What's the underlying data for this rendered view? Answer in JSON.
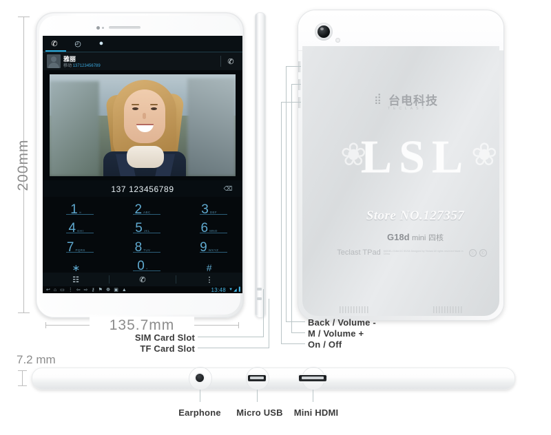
{
  "dimensions": {
    "height_label": "200mm",
    "width_label": "135.7mm",
    "thickness_label": "7.2 mm"
  },
  "callouts": {
    "left": [
      {
        "label": "SIM Card Slot"
      },
      {
        "label": "TF Card Slot"
      }
    ],
    "right": [
      {
        "label": "Back / Volume -"
      },
      {
        "label": "M / Volume +"
      },
      {
        "label": "On / Off"
      }
    ],
    "bottom": [
      {
        "label": "Earphone",
        "icon": "headphone-jack-icon"
      },
      {
        "label": "Micro USB",
        "icon": "micro-usb-icon"
      },
      {
        "label": "Mini HDMI",
        "icon": "mini-hdmi-icon"
      }
    ]
  },
  "phone_screen": {
    "tabs": [
      {
        "name": "dialer-tab",
        "icon": "phone-icon",
        "glyph": "✆",
        "active": true
      },
      {
        "name": "recents-tab",
        "icon": "clock-icon",
        "glyph": "◴",
        "active": false
      },
      {
        "name": "contacts-tab",
        "icon": "person-icon",
        "glyph": "●",
        "active": false
      }
    ],
    "contact": {
      "name": "雅丽",
      "label": "移动",
      "number": "137123456789",
      "call_icon": "phone-icon",
      "avatar_icon": "avatar-icon"
    },
    "dialed_number": "137 123456789",
    "backspace_icon": "backspace-icon",
    "keys": [
      {
        "digit": "1",
        "sub": "∞"
      },
      {
        "digit": "2",
        "sub": "ABC"
      },
      {
        "digit": "3",
        "sub": "DEF"
      },
      {
        "digit": "4",
        "sub": "GHI"
      },
      {
        "digit": "5",
        "sub": "JKL"
      },
      {
        "digit": "6",
        "sub": "MNO"
      },
      {
        "digit": "7",
        "sub": "PQRS"
      },
      {
        "digit": "8",
        "sub": "TUV"
      },
      {
        "digit": "9",
        "sub": "WXYZ"
      },
      {
        "digit": "∗",
        "sub": ""
      },
      {
        "digit": "0",
        "sub": "+"
      },
      {
        "digit": "#",
        "sub": ""
      }
    ],
    "actions": [
      {
        "name": "keypad-button",
        "glyph": "☷"
      },
      {
        "name": "call-button",
        "glyph": "✆"
      },
      {
        "name": "overflow-menu-button",
        "glyph": "⋮"
      }
    ],
    "navbar": {
      "icons": [
        {
          "name": "back-icon",
          "glyph": "↩"
        },
        {
          "name": "home-icon",
          "glyph": "⌂"
        },
        {
          "name": "recents-icon",
          "glyph": "▭"
        },
        {
          "name": "menu-icon",
          "glyph": "⋮"
        },
        {
          "name": "volume-down-icon",
          "glyph": "⇦"
        },
        {
          "name": "volume-up-icon",
          "glyph": "⇨"
        },
        {
          "name": "usb-icon",
          "glyph": "⚷"
        },
        {
          "name": "gps-icon",
          "glyph": "⚑"
        },
        {
          "name": "sync-icon",
          "glyph": "☸"
        },
        {
          "name": "sd-card-icon",
          "glyph": "▣"
        },
        {
          "name": "warning-icon",
          "glyph": "▲"
        }
      ],
      "time": "13:48",
      "status_icons": [
        {
          "name": "wifi-icon",
          "glyph": "▼"
        },
        {
          "name": "signal-icon",
          "glyph": "◢"
        },
        {
          "name": "battery-icon",
          "glyph": "▐"
        }
      ]
    }
  },
  "back_panel": {
    "brand_mark_icon": "teclast-logo-icon",
    "brand_cn": "台电科技",
    "brand_sub": "TECLAST",
    "watermark": "LSL",
    "flourish_left": "❀",
    "flourish_right": "❀",
    "store_no": "Store NO.127357",
    "model_name": "G18d",
    "model_variant": "mini",
    "model_cn": "四核",
    "reg_brand": "Teclast TPad",
    "reg_fine_print": "MODEL:G18d  DC 5V/2A  Designed by Teclast  All rights reserved  Made in China",
    "cert_marks": [
      {
        "name": "ccc-cert-icon",
        "glyph": "Ⓘ"
      },
      {
        "name": "ce-cert-icon",
        "glyph": "Ⓒ"
      }
    ],
    "camera_icon": "rear-camera-icon",
    "flash_icon": "camera-flash-icon",
    "speaker_icon": "speaker-grille-icon"
  }
}
